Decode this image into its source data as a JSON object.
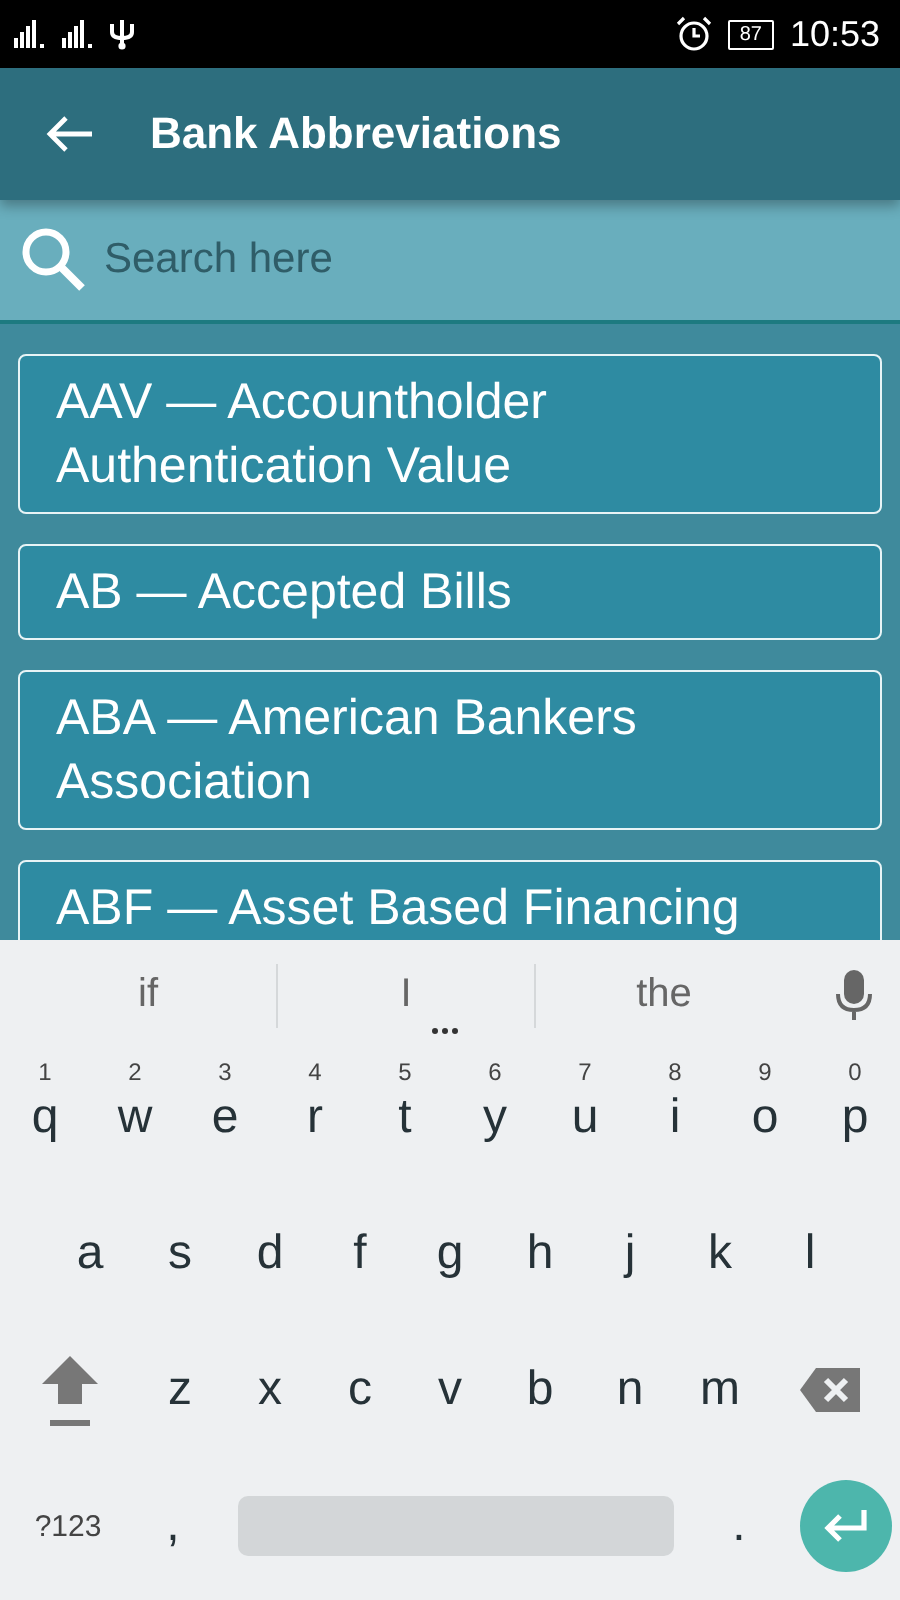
{
  "status_bar": {
    "battery": "87",
    "time": "10:53"
  },
  "app_bar": {
    "title": "Bank Abbreviations"
  },
  "search": {
    "placeholder": "Search here"
  },
  "items": [
    {
      "text": "AAV — Accountholder Authentication Value"
    },
    {
      "text": "AB — Accepted Bills"
    },
    {
      "text": "ABA — American Bankers Association"
    },
    {
      "text": "ABF — Asset Based Financing"
    }
  ],
  "keyboard": {
    "suggestions": [
      "if",
      "I",
      "the"
    ],
    "rows": [
      [
        {
          "label": "q",
          "hint": "1"
        },
        {
          "label": "w",
          "hint": "2"
        },
        {
          "label": "e",
          "hint": "3"
        },
        {
          "label": "r",
          "hint": "4"
        },
        {
          "label": "t",
          "hint": "5"
        },
        {
          "label": "y",
          "hint": "6"
        },
        {
          "label": "u",
          "hint": "7"
        },
        {
          "label": "i",
          "hint": "8"
        },
        {
          "label": "o",
          "hint": "9"
        },
        {
          "label": "p",
          "hint": "0"
        }
      ],
      [
        {
          "label": "a"
        },
        {
          "label": "s"
        },
        {
          "label": "d"
        },
        {
          "label": "f"
        },
        {
          "label": "g"
        },
        {
          "label": "h"
        },
        {
          "label": "j"
        },
        {
          "label": "k"
        },
        {
          "label": "l"
        }
      ],
      [
        {
          "kind": "shift"
        },
        {
          "label": "z"
        },
        {
          "label": "x"
        },
        {
          "label": "c"
        },
        {
          "label": "v"
        },
        {
          "label": "b"
        },
        {
          "label": "n"
        },
        {
          "label": "m"
        },
        {
          "kind": "backspace"
        }
      ],
      [
        {
          "kind": "symbols",
          "label": "?123"
        },
        {
          "label": ","
        },
        {
          "kind": "space"
        },
        {
          "label": "."
        },
        {
          "kind": "enter"
        }
      ]
    ]
  }
}
